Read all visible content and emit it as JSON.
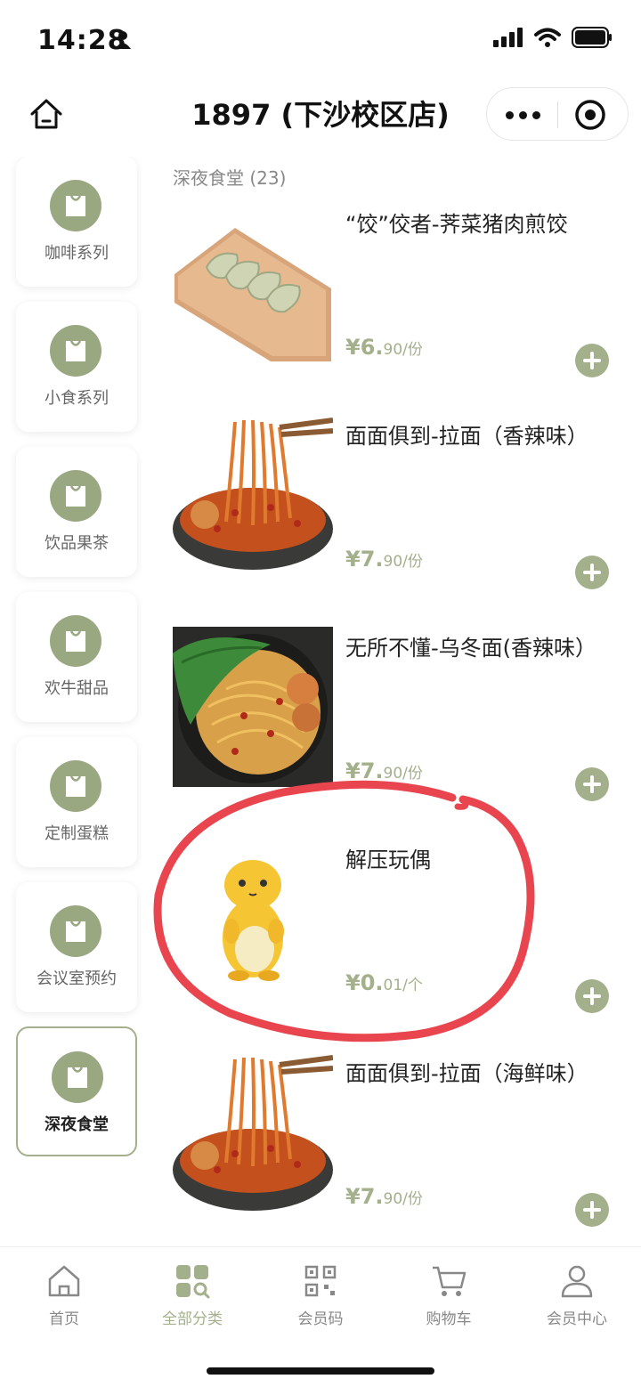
{
  "status_bar": {
    "time": "14:28"
  },
  "nav": {
    "title": "1897 (下沙校区店)"
  },
  "sidebar": {
    "items": [
      {
        "label": "咖啡系列",
        "active": false
      },
      {
        "label": "小食系列",
        "active": false
      },
      {
        "label": "饮品果茶",
        "active": false
      },
      {
        "label": "欢牛甜品",
        "active": false
      },
      {
        "label": "定制蛋糕",
        "active": false
      },
      {
        "label": "会议室预约",
        "active": false
      },
      {
        "label": "深夜食堂",
        "active": true
      }
    ]
  },
  "section": {
    "title": "深夜食堂 (23)"
  },
  "products": [
    {
      "name": "“饺”佼者-荠菜猪肉煎饺",
      "price_main": "¥6.",
      "price_cents": "90/份",
      "image": "dumplings"
    },
    {
      "name": "面面俱到-拉面（香辣味）",
      "price_main": "¥7.",
      "price_cents": "90/份",
      "image": "spicy-noodles"
    },
    {
      "name": "无所不懂-乌冬面(香辣味）",
      "price_main": "¥7.",
      "price_cents": "90/份",
      "image": "udon"
    },
    {
      "name": "解压玩偶",
      "price_main": "¥0.",
      "price_cents": "01/个",
      "image": "squishy-toy"
    },
    {
      "name": "面面俱到-拉面（海鲜味）",
      "price_main": "¥7.",
      "price_cents": "90/份",
      "image": "seafood-noodles"
    }
  ],
  "tabs": [
    {
      "label": "首页",
      "icon": "home-icon",
      "active": false
    },
    {
      "label": "全部分类",
      "icon": "category-icon",
      "active": true
    },
    {
      "label": "会员码",
      "icon": "qr-code-icon",
      "active": false
    },
    {
      "label": "购物车",
      "icon": "cart-icon",
      "active": false
    },
    {
      "label": "会员中心",
      "icon": "person-icon",
      "active": false
    }
  ],
  "colors": {
    "accent": "#a3b08b",
    "accent_dark": "#9aa882",
    "highlight": "#e8454f"
  }
}
